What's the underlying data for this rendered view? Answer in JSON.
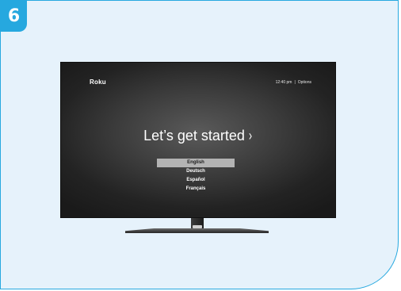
{
  "step": {
    "number": "6"
  },
  "tv": {
    "brand": "Roku",
    "status": {
      "time": "12:40 pm",
      "separator": "|",
      "options": "Options"
    },
    "headline": "Let’s get started",
    "headline_chevron": "›",
    "languages": [
      {
        "label": "English",
        "selected": true
      },
      {
        "label": "Deutsch",
        "selected": false
      },
      {
        "label": "Español",
        "selected": false
      },
      {
        "label": "Français",
        "selected": false
      }
    ]
  },
  "colors": {
    "accent": "#26a8df",
    "card_background": "#e6f2fb",
    "screen_background": "#2e2e2e",
    "selection_highlight": "#b3b3b3"
  }
}
